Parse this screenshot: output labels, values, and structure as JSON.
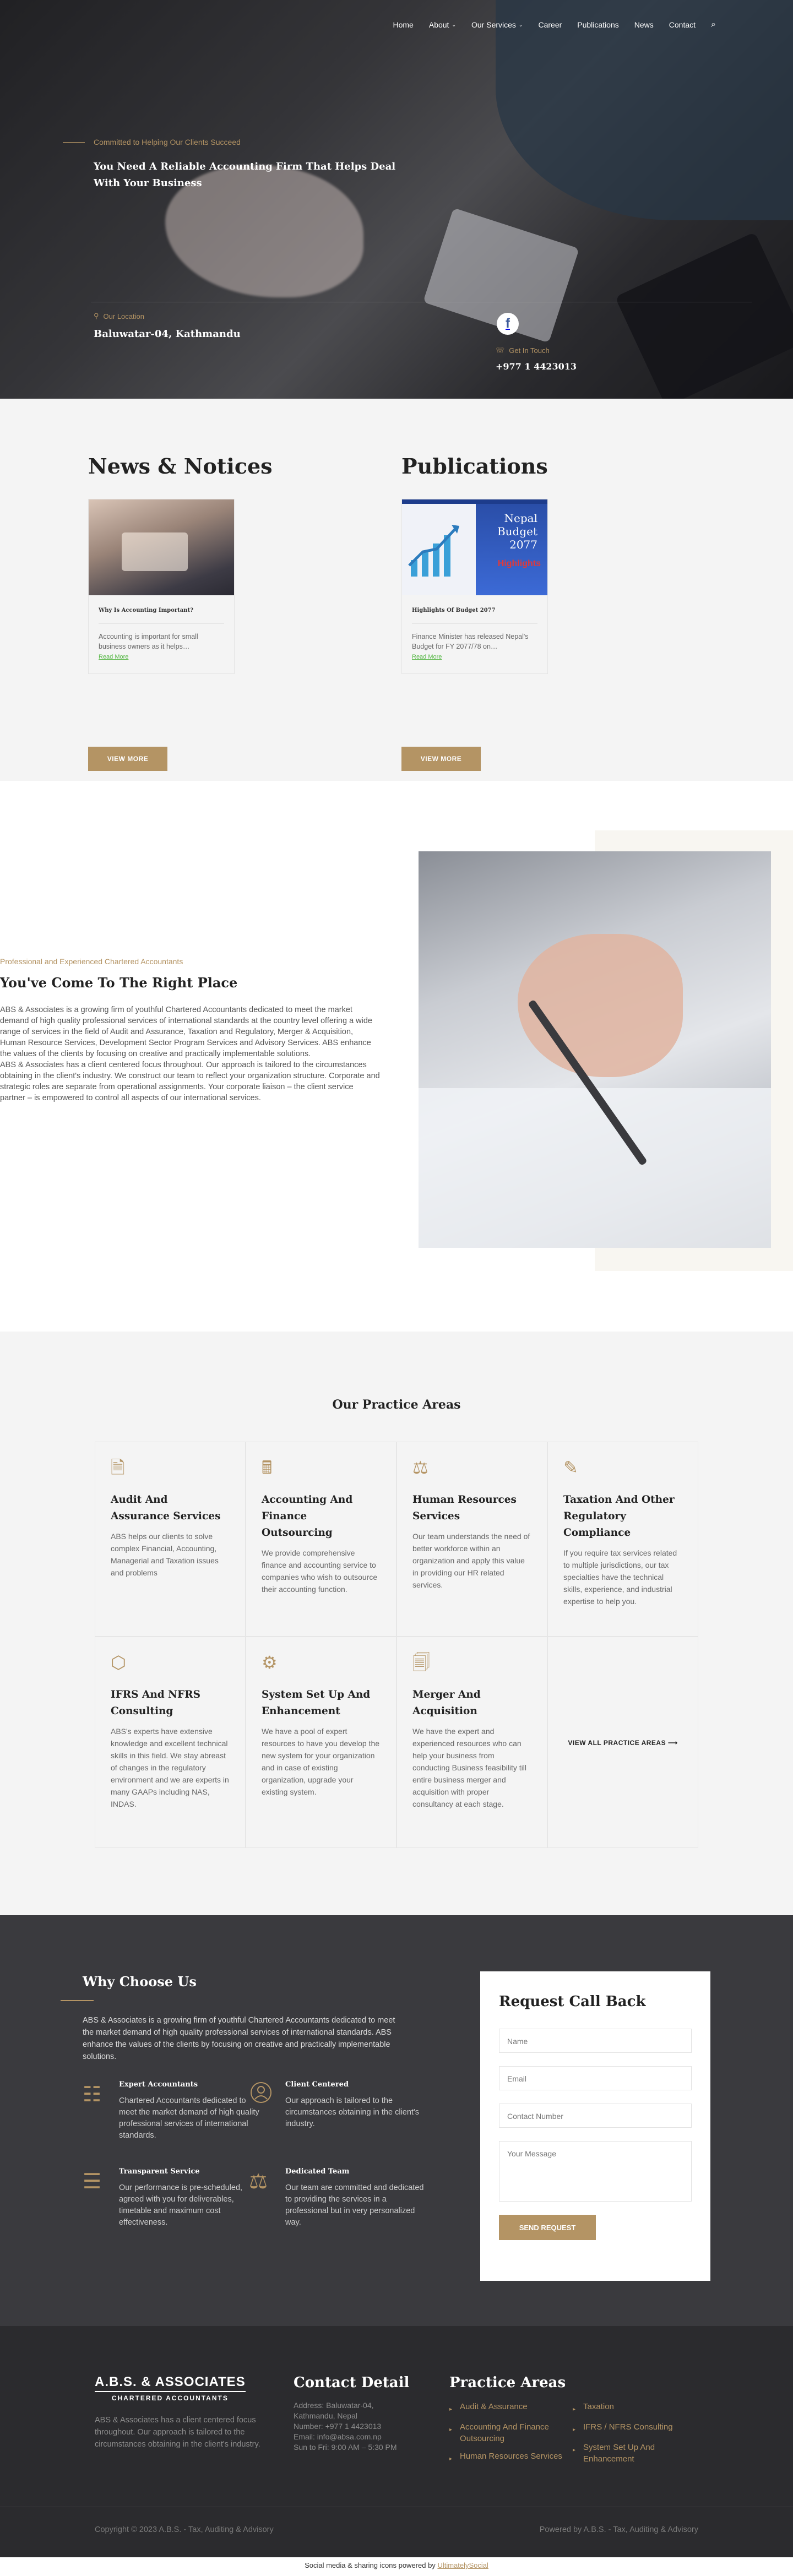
{
  "nav": {
    "home": "Home",
    "about": "About",
    "services": "Our Services",
    "career": "Career",
    "publications": "Publications",
    "news": "News",
    "contact": "Contact"
  },
  "hero": {
    "tagline": "Committed to Helping Our Clients Succeed",
    "title": "You Need A Reliable Accounting Firm That Helps Deal With Your Business",
    "location_label": "Our Location",
    "location_value": "Baluwatar-04, Kathmandu",
    "touch_label": "Get In Touch",
    "touch_value": "+977 1 4423013",
    "fb_letter": "f"
  },
  "news": {
    "heading": "News & Notices",
    "card_title": "Why Is Accounting Important?",
    "card_text": "Accounting is important for small business owners as it helps…",
    "read_more": "Read More",
    "view_more": "VIEW MORE"
  },
  "publications": {
    "heading": "Publications",
    "card_title": "Highlights Of Budget 2077",
    "card_text": "Finance Minister has released Nepal's Budget for FY 2077/78 on…",
    "read_more": "Read More",
    "view_more": "VIEW MORE",
    "image_text_line1": "Nepal",
    "image_text_line2": "Budget",
    "image_text_line3": "2077",
    "image_highlight": "Highlights"
  },
  "about": {
    "tagline": "Professional and Experienced Chartered Accountants",
    "title": "You've Come To The Right Place",
    "paragraph1": "ABS & Associates is a growing firm of youthful Chartered Accountants dedicated to meet the market demand of high quality professional services of international standards at the country level offering a wide range of services in the field of Audit and Assurance, Taxation and Regulatory, Merger & Acquisition, Human Resource Services, Development Sector Program Services and Advisory Services. ABS enhance the values of the clients by focusing on creative and practically implementable solutions.",
    "paragraph2": "ABS & Associates has a client centered focus throughout. Our approach is tailored to the circumstances obtaining in the client's industry. We construct our team to reflect your organization structure. Corporate and strategic roles are separate from operational assignments. Your corporate liaison – the client service partner – is empowered to control all aspects of our international services."
  },
  "practice": {
    "heading": "Our Practice Areas",
    "items": [
      {
        "icon": "audit-icon",
        "glyph": "🗎",
        "title": "Audit And Assurance Services",
        "text": "ABS helps our clients to solve complex Financial, Accounting, Managerial and Taxation issues and problems"
      },
      {
        "icon": "accounting-icon",
        "glyph": "🖩",
        "title": "Accounting And Finance Outsourcing",
        "text": "We provide comprehensive finance and accounting service to companies who wish to outsource their accounting function."
      },
      {
        "icon": "hr-icon",
        "glyph": "⚖",
        "title": "Human Resources Services",
        "text": "Our team understands the need of better workforce within an organization and apply this value in providing our HR related services."
      },
      {
        "icon": "tax-icon",
        "glyph": "✎",
        "title": "Taxation And Other Regulatory Compliance",
        "text": "If you require tax services related to multiple jurisdictions, our tax specialties have the technical skills, experience, and industrial expertise to help you."
      },
      {
        "icon": "ifrs-icon",
        "glyph": "⬡",
        "title": "IFRS And NFRS Consulting",
        "text": "ABS's experts have extensive knowledge and excellent technical skills in this field. We stay abreast of changes in the regulatory environment and we are experts in many GAAPs including NAS, INDAS."
      },
      {
        "icon": "system-icon",
        "glyph": "⚙",
        "title": "System Set Up And Enhancement",
        "text": "We have a pool of expert resources to have you develop the new system for your organization and in case of existing organization, upgrade your existing system."
      },
      {
        "icon": "merger-icon",
        "glyph": "🗐",
        "title": "Merger And Acquisition",
        "text": "We have the expert and experienced resources who can help your business from conducting Business feasibility till entire business merger and acquisition with proper consultancy at each stage."
      }
    ],
    "view_all": "VIEW ALL PRACTICE AREAS",
    "arrow": "⟶"
  },
  "why": {
    "heading": "Why Choose Us",
    "intro": "ABS & Associates is a growing firm of youthful Chartered Accountants dedicated to meet the market demand of high quality professional services of international standards. ABS enhance the values of the clients by focusing on creative and practically implementable solutions.",
    "features": [
      {
        "icon": "expert-icon",
        "glyph": "☷",
        "title": "Expert Accountants",
        "text": "Chartered Accountants dedicated to meet the market demand of high quality professional services of international standards."
      },
      {
        "icon": "client-icon",
        "glyph": "",
        "title": "Client Centered",
        "text": "Our approach is tailored to the circumstances obtaining in the client's industry."
      },
      {
        "icon": "transparent-icon",
        "glyph": "☰",
        "title": "Transparent Service",
        "text": "Our performance is pre-scheduled, agreed with you for deliverables, timetable and maximum cost effectiveness."
      },
      {
        "icon": "team-icon",
        "glyph": "⚖",
        "title": "Dedicated Team",
        "text": "Our team are committed and dedicated to providing the services in a professional but in very personalized way."
      }
    ]
  },
  "form": {
    "heading": "Request Call Back",
    "name": "Name",
    "email": "Email",
    "contact": "Contact Number",
    "message": "Your Message",
    "send": "SEND REQUEST"
  },
  "footer": {
    "logo_line1": "A.B.S. & ASSOCIATES",
    "logo_line2": "CHARTERED ACCOUNTANTS",
    "about_text": "ABS & Associates has a client centered focus throughout. Our approach is tailored to the circumstances obtaining in the client's industry.",
    "contact_heading": "Contact Detail",
    "address1": "Address: Baluwatar-04,",
    "address2": "Kathmandu, Nepal",
    "phone": "Number: +977 1 4423013",
    "email": "Email: info@absa.com.np",
    "hours": "Sun to Fri: 9:00 AM – 5:30 PM",
    "practice_heading": "Practice Areas",
    "practice_col1": [
      "Audit & Assurance",
      "Accounting And Finance Outsourcing",
      "Human Resources Services"
    ],
    "practice_col2": [
      "Taxation",
      "IFRS / NFRS Consulting",
      "System Set Up And Enhancement"
    ],
    "copyright": "Copyright © 2023 A.B.S. - Tax, Auditing & Advisory",
    "powered": "Powered by A.B.S. - Tax, Auditing & Advisory"
  },
  "social_bar": {
    "text": "Social media & sharing icons powered by",
    "link": "UltimatelySocial"
  },
  "colors": {
    "accent": "#b49464",
    "dark": "#3a3a3e",
    "footer": "#2b2b2e",
    "light_bg": "#f4f4f4"
  }
}
